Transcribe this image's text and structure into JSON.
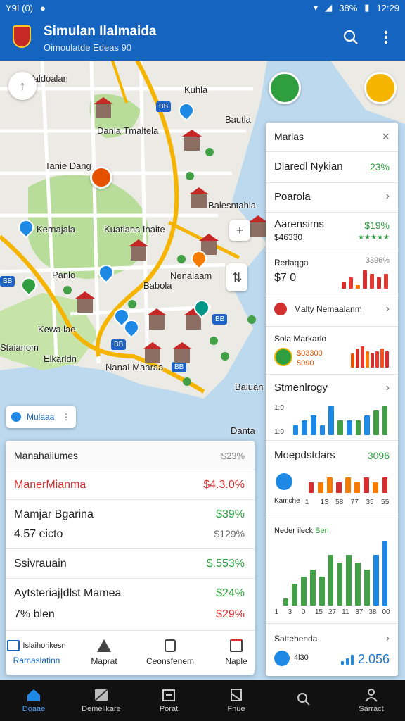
{
  "status_bar": {
    "left_text": "Y9I (0)",
    "battery": "38%",
    "time": "12:29"
  },
  "app_bar": {
    "title": "Simulan Ilalmaida",
    "subtitle": "Oimoulatde Edeas 90",
    "search_icon": "search-icon",
    "menu_icon": "more-vert-icon"
  },
  "map": {
    "labels": {
      "l1": "Yaldoalan",
      "l2": "Kuhla",
      "l3": "Bautla",
      "l4": "Danla Tmaltela",
      "l5": "Tanie Dang",
      "l6": "Kernajala",
      "l7": "Kuatlana Inaite",
      "l8": "Balesntahia",
      "l9": "Nenalaam",
      "l10": "Babola",
      "l11": "Kewa lae",
      "l12": "Staianom",
      "l13": "Elkarldn",
      "l14": "NanaI Maaraa",
      "l15": "Baluan",
      "l16": "Danta",
      "l17": "Panlo"
    },
    "chip_label": "Mulaaa"
  },
  "right_panel": {
    "header": "Marlas",
    "row1": {
      "label": "Dlaredl Nykian",
      "value": "23%"
    },
    "row2": {
      "label": "Poarola"
    },
    "row3": {
      "label": "Aarensims",
      "sub": "$46330",
      "value": "$19%"
    },
    "row4": {
      "label": "Rerlaqga",
      "value": "$7 0",
      "pct": "3396%"
    },
    "row5": {
      "label": "Malty Nemaalanm"
    },
    "row6": {
      "label": "Sola Markarlo",
      "sub1": "$03300",
      "sub2": "5090"
    },
    "row7": {
      "label": "Stmenlrogy",
      "ticks": [
        "1:0",
        "1:0"
      ]
    },
    "row8": {
      "label": "Moepdstdars",
      "value": "3096",
      "sub": "Kamche",
      "xticks": [
        "1",
        "1S",
        "58",
        "77",
        "35",
        "55"
      ]
    },
    "row9": {
      "label": "Neder ileck",
      "accent": "Ben",
      "xticks": [
        "1",
        "3",
        "0",
        "15",
        "27",
        "11",
        "37",
        "38",
        "00"
      ]
    },
    "row10": {
      "label": "Sattehenda",
      "sub": "4l30",
      "value": "2.056"
    }
  },
  "chart_data": [
    {
      "type": "bar",
      "title": "",
      "values": [
        2,
        3,
        1,
        5,
        4,
        3,
        4
      ],
      "colors": [
        "#d32f2f",
        "#e53935",
        "#f57c00",
        "#d32f2f",
        "#e53935",
        "#d32f2f",
        "#e53935"
      ]
    },
    {
      "type": "bar",
      "title": "",
      "values": [
        6,
        8,
        9,
        7,
        6,
        7,
        8,
        7
      ],
      "colors": [
        "#e65100",
        "#d32f2f",
        "#e53935",
        "#f57c00",
        "#d32f2f",
        "#e53935",
        "#f4511e",
        "#d32f2f"
      ]
    },
    {
      "type": "bar",
      "title": "",
      "values": [
        2,
        3,
        4,
        2,
        6,
        3,
        3,
        3,
        4,
        5,
        6
      ],
      "colors": [
        "#1e88e5",
        "#1e88e5",
        "#1e88e5",
        "#1e88e5",
        "#1e88e5",
        "#43a047",
        "#1e88e5",
        "#43a047",
        "#1e88e5",
        "#43a047",
        "#43a047"
      ]
    },
    {
      "type": "bar",
      "title": "",
      "values": [
        2,
        2,
        3,
        2,
        3,
        2,
        3,
        2,
        3
      ],
      "colors": [
        "#d32f2f",
        "#f57c00",
        "#f57c00",
        "#d32f2f",
        "#f57c00",
        "#f57c00",
        "#d32f2f",
        "#f57c00",
        "#d32f2f"
      ]
    },
    {
      "type": "bar",
      "title": "",
      "values": [
        1,
        3,
        4,
        5,
        4,
        7,
        6,
        7,
        6,
        5,
        7,
        9
      ],
      "colors": [
        "#43a047",
        "#43a047",
        "#43a047",
        "#43a047",
        "#43a047",
        "#43a047",
        "#43a047",
        "#43a047",
        "#43a047",
        "#43a047",
        "#1e88e5",
        "#1e88e5"
      ]
    },
    {
      "type": "bar",
      "title": "",
      "values": [
        1,
        2,
        3
      ],
      "colors": [
        "#1e88e5",
        "#1e88e5",
        "#1e88e5"
      ]
    }
  ],
  "left_card": {
    "header": {
      "label": "Manahaiiumes",
      "value": "$23%"
    },
    "rows": [
      {
        "label": "ManerMianma",
        "value": "$4.3.0%",
        "label_color": "#d32f2f",
        "value_color": "#d32f2f"
      },
      {
        "label": "Mamjar Bgarina",
        "value": "$39%",
        "value_color": "#2e9e3e"
      },
      {
        "label": "4.57 eicto",
        "value": "$129%",
        "value_color": "#666"
      },
      {
        "label": "Ssivrauain",
        "value": "$.553%",
        "value_color": "#2e9e3e"
      },
      {
        "label": "Aytsteriaj|dlst Mamea",
        "value": "$24%",
        "value_color": "#2e9e3e"
      },
      {
        "label": "7% blen",
        "value": "$29%",
        "value_color": "#d32f2f"
      }
    ],
    "tabs": [
      {
        "top": "Islaihorikesn",
        "bottom": "Ramaslatinn"
      },
      {
        "top": "",
        "bottom": "Maprat"
      },
      {
        "top": "",
        "bottom": "Ceonsfenem"
      },
      {
        "top": "",
        "bottom": "Naple"
      }
    ]
  },
  "bottom_nav": [
    {
      "label": "Doaae",
      "icon": "home-icon"
    },
    {
      "label": "Demelikare",
      "icon": "layers-icon"
    },
    {
      "label": "Porat",
      "icon": "calendar-icon"
    },
    {
      "label": "Fnue",
      "icon": "flag-icon"
    },
    {
      "label": "",
      "icon": "search-icon"
    },
    {
      "label": "Sarract",
      "icon": "person-icon"
    }
  ]
}
